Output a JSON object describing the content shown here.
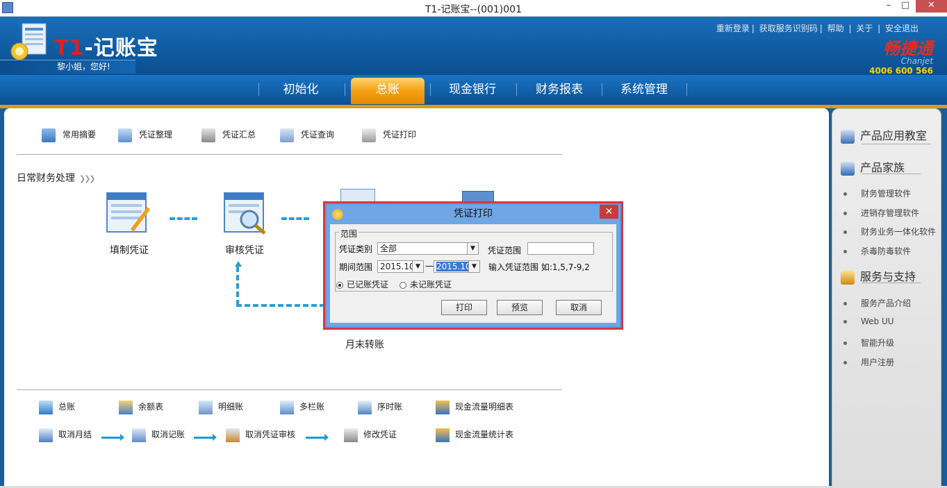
{
  "window": {
    "title": "T1-记账宝--(001)001",
    "minimize": "–",
    "maximize": "□",
    "close": "✕"
  },
  "header": {
    "logo_prefix": "T1",
    "logo_text": "-记账宝",
    "greeting": "黎小姐，您好!",
    "links": [
      "重新登录",
      "获取服务识别码",
      "帮助",
      "关于",
      "安全退出"
    ],
    "brand_name": "畅捷通",
    "brand_en": "Chanjet",
    "brand_phone": "4006 600 566"
  },
  "nav": {
    "items": [
      "初始化",
      "总账",
      "现金银行",
      "财务报表",
      "系统管理"
    ],
    "active": "总账"
  },
  "toolbar": {
    "items": [
      "常用摘要",
      "凭证整理",
      "凭证汇总",
      "凭证查询",
      "凭证打印"
    ]
  },
  "section": {
    "title": "日常财务处理"
  },
  "flow": {
    "make": "填制凭证",
    "audit": "审核凭证",
    "month_end": "月末转账"
  },
  "bottom": {
    "row1": [
      "总账",
      "余额表",
      "明细账",
      "多栏账",
      "序时账",
      "现金流量明细表"
    ],
    "row2": [
      "取消月结",
      "取消记账",
      "取消凭证审核",
      "修改凭证",
      "现金流量统计表"
    ]
  },
  "right_panel": {
    "classroom": "产品应用教室",
    "family": "产品家族",
    "family_items": [
      "财务管理软件",
      "进销存管理软件",
      "财务业务一体化软件",
      "杀毒防毒软件"
    ],
    "service": "服务与支持",
    "service_items": [
      "服务产品介绍",
      "Web UU",
      "智能升级",
      "用户注册"
    ]
  },
  "dialog": {
    "title": "凭证打印",
    "close": "✕",
    "group_label": "范围",
    "type_label": "凭证类别",
    "type_value": "全部",
    "range_label": "凭证范围",
    "range_value": "",
    "period_label": "期间范围",
    "period_from": "2015.10",
    "period_sep": "一",
    "period_to": "2015.10",
    "hint": "输入凭证范围 如:1,5,7-9,2",
    "radio_posted": "已记账凭证",
    "radio_unposted": "未记账凭证",
    "btn_print": "打印",
    "btn_preview": "预览",
    "btn_cancel": "取消"
  },
  "colors": {
    "header_blue": "#0f5aa0",
    "active_tab": "#f5a114",
    "dialog_border": "#d9363e",
    "brand_red": "#e03020"
  }
}
